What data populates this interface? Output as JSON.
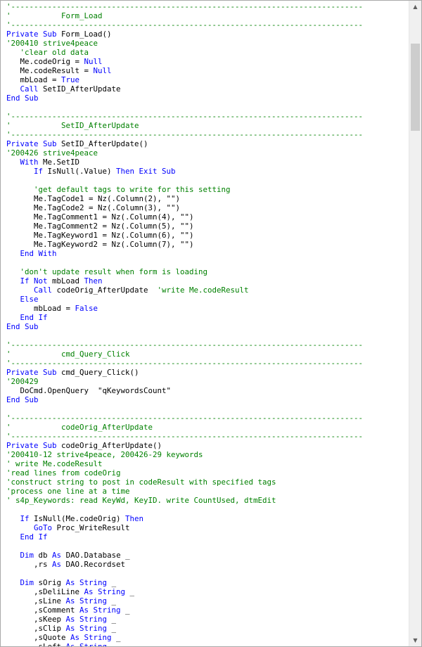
{
  "editor": {
    "lines": [
      [
        [
          "c",
          "'-----------------------------------------------------------------------------"
        ]
      ],
      [
        [
          "c",
          "'           Form_Load"
        ]
      ],
      [
        [
          "c",
          "'-----------------------------------------------------------------------------"
        ]
      ],
      [
        [
          "k",
          "Private Sub "
        ],
        [
          "t",
          "Form_Load()"
        ]
      ],
      [
        [
          "c",
          "'200410 strive4peace"
        ]
      ],
      [
        [
          "t",
          "   "
        ],
        [
          "c",
          "'clear old data"
        ]
      ],
      [
        [
          "t",
          "   Me.codeOrig = "
        ],
        [
          "k",
          "Null"
        ]
      ],
      [
        [
          "t",
          "   Me.codeResult = "
        ],
        [
          "k",
          "Null"
        ]
      ],
      [
        [
          "t",
          "   mbLoad = "
        ],
        [
          "k",
          "True"
        ]
      ],
      [
        [
          "t",
          "   "
        ],
        [
          "k",
          "Call "
        ],
        [
          "t",
          "SetID_AfterUpdate"
        ]
      ],
      [
        [
          "k",
          "End Sub"
        ]
      ],
      [],
      [
        [
          "c",
          "'-----------------------------------------------------------------------------"
        ]
      ],
      [
        [
          "c",
          "'           SetID_AfterUpdate"
        ]
      ],
      [
        [
          "c",
          "'-----------------------------------------------------------------------------"
        ]
      ],
      [
        [
          "k",
          "Private Sub "
        ],
        [
          "t",
          "SetID_AfterUpdate()"
        ]
      ],
      [
        [
          "c",
          "'200426 strive4peace"
        ]
      ],
      [
        [
          "t",
          "   "
        ],
        [
          "k",
          "With "
        ],
        [
          "t",
          "Me.SetID"
        ]
      ],
      [
        [
          "t",
          "      "
        ],
        [
          "k",
          "If "
        ],
        [
          "t",
          "IsNull(.Value) "
        ],
        [
          "k",
          "Then Exit Sub"
        ]
      ],
      [],
      [
        [
          "t",
          "      "
        ],
        [
          "c",
          "'get default tags to write for this setting"
        ]
      ],
      [
        [
          "t",
          "      Me.TagCode1 = Nz(.Column(2), \"\")"
        ]
      ],
      [
        [
          "t",
          "      Me.TagCode2 = Nz(.Column(3), \"\")"
        ]
      ],
      [
        [
          "t",
          "      Me.TagComment1 = Nz(.Column(4), \"\")"
        ]
      ],
      [
        [
          "t",
          "      Me.TagComment2 = Nz(.Column(5), \"\")"
        ]
      ],
      [
        [
          "t",
          "      Me.TagKeyword1 = Nz(.Column(6), \"\")"
        ]
      ],
      [
        [
          "t",
          "      Me.TagKeyword2 = Nz(.Column(7), \"\")"
        ]
      ],
      [
        [
          "t",
          "   "
        ],
        [
          "k",
          "End With"
        ]
      ],
      [],
      [
        [
          "t",
          "   "
        ],
        [
          "c",
          "'don't update result when form is loading"
        ]
      ],
      [
        [
          "t",
          "   "
        ],
        [
          "k",
          "If Not "
        ],
        [
          "t",
          "mbLoad "
        ],
        [
          "k",
          "Then"
        ]
      ],
      [
        [
          "t",
          "      "
        ],
        [
          "k",
          "Call "
        ],
        [
          "t",
          "codeOrig_AfterUpdate  "
        ],
        [
          "c",
          "'write Me.codeResult"
        ]
      ],
      [
        [
          "t",
          "   "
        ],
        [
          "k",
          "Else"
        ]
      ],
      [
        [
          "t",
          "      mbLoad = "
        ],
        [
          "k",
          "False"
        ]
      ],
      [
        [
          "t",
          "   "
        ],
        [
          "k",
          "End If"
        ]
      ],
      [
        [
          "k",
          "End Sub"
        ]
      ],
      [],
      [
        [
          "c",
          "'-----------------------------------------------------------------------------"
        ]
      ],
      [
        [
          "c",
          "'           cmd_Query_Click"
        ]
      ],
      [
        [
          "c",
          "'-----------------------------------------------------------------------------"
        ]
      ],
      [
        [
          "k",
          "Private Sub "
        ],
        [
          "t",
          "cmd_Query_Click()"
        ]
      ],
      [
        [
          "c",
          "'200429"
        ]
      ],
      [
        [
          "t",
          "   DoCmd.OpenQuery  \"qKeywordsCount\""
        ]
      ],
      [
        [
          "k",
          "End Sub"
        ]
      ],
      [],
      [
        [
          "c",
          "'-----------------------------------------------------------------------------"
        ]
      ],
      [
        [
          "c",
          "'           codeOrig_AfterUpdate"
        ]
      ],
      [
        [
          "c",
          "'-----------------------------------------------------------------------------"
        ]
      ],
      [
        [
          "k",
          "Private Sub "
        ],
        [
          "t",
          "codeOrig_AfterUpdate()"
        ]
      ],
      [
        [
          "c",
          "'200410-12 strive4peace, 200426-29 keywords"
        ]
      ],
      [
        [
          "c",
          "' write Me.codeResult"
        ]
      ],
      [
        [
          "c",
          "'read lines from codeOrig"
        ]
      ],
      [
        [
          "c",
          "'construct string to post in codeResult with specified tags"
        ]
      ],
      [
        [
          "c",
          "'process one line at a time"
        ]
      ],
      [
        [
          "c",
          "' s4p_Keywords: read KeyWd, KeyID. write CountUsed, dtmEdit"
        ]
      ],
      [],
      [
        [
          "t",
          "   "
        ],
        [
          "k",
          "If "
        ],
        [
          "t",
          "IsNull(Me.codeOrig) "
        ],
        [
          "k",
          "Then"
        ]
      ],
      [
        [
          "t",
          "      "
        ],
        [
          "k",
          "GoTo "
        ],
        [
          "t",
          "Proc_WriteResult"
        ]
      ],
      [
        [
          "t",
          "   "
        ],
        [
          "k",
          "End If"
        ]
      ],
      [],
      [
        [
          "t",
          "   "
        ],
        [
          "k",
          "Dim "
        ],
        [
          "t",
          "db "
        ],
        [
          "k",
          "As "
        ],
        [
          "t",
          "DAO.Database _"
        ]
      ],
      [
        [
          "t",
          "      ,rs "
        ],
        [
          "k",
          "As "
        ],
        [
          "t",
          "DAO.Recordset"
        ]
      ],
      [],
      [
        [
          "t",
          "   "
        ],
        [
          "k",
          "Dim "
        ],
        [
          "t",
          "sOrig "
        ],
        [
          "k",
          "As String "
        ],
        [
          "t",
          "_"
        ]
      ],
      [
        [
          "t",
          "      ,sDeliLine "
        ],
        [
          "k",
          "As String "
        ],
        [
          "t",
          "_"
        ]
      ],
      [
        [
          "t",
          "      ,sLine "
        ],
        [
          "k",
          "As String "
        ],
        [
          "t",
          "_"
        ]
      ],
      [
        [
          "t",
          "      ,sComment "
        ],
        [
          "k",
          "As String "
        ],
        [
          "t",
          "_"
        ]
      ],
      [
        [
          "t",
          "      ,sKeep "
        ],
        [
          "k",
          "As String "
        ],
        [
          "t",
          "_"
        ]
      ],
      [
        [
          "t",
          "      ,sClip "
        ],
        [
          "k",
          "As String "
        ],
        [
          "t",
          "_"
        ]
      ],
      [
        [
          "t",
          "      ,sQuote "
        ],
        [
          "k",
          "As String "
        ],
        [
          "t",
          "_"
        ]
      ],
      [
        [
          "t",
          "      ,sLeft "
        ],
        [
          "k",
          "As String "
        ],
        [
          "t",
          "_"
        ]
      ]
    ],
    "colors": {
      "keyword": "#0000ff",
      "comment": "#008000",
      "text": "#000000"
    }
  },
  "scrollbar": {
    "up_icon": "scroll-up-arrow",
    "down_icon": "scroll-down-arrow",
    "position_fraction": 0.06
  }
}
